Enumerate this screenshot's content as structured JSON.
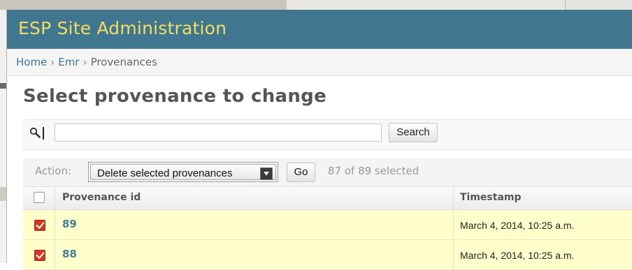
{
  "header": {
    "title": "ESP Site Administration"
  },
  "breadcrumbs": {
    "items": [
      "Home",
      "Emr",
      "Provenances"
    ],
    "separator": "›"
  },
  "page_title": "Select provenance to change",
  "search": {
    "value": "",
    "placeholder": "",
    "button_label": "Search",
    "icon": "magnifier-icon"
  },
  "actions": {
    "label": "Action:",
    "selected_option": "Delete selected provenances",
    "go_label": "Go",
    "selected_count_text": "87 of 89 selected"
  },
  "table": {
    "columns": [
      "Provenance id",
      "Timestamp"
    ],
    "rows": [
      {
        "id": "89",
        "timestamp": "March 4, 2014, 10:25 a.m.",
        "checked": true
      },
      {
        "id": "88",
        "timestamp": "March 4, 2014, 10:25 a.m.",
        "checked": true
      }
    ]
  },
  "colors": {
    "header_bg": "#417690",
    "header_text": "#f5dd5d",
    "link": "#447e9b",
    "selected_row_bg": "#ffffcc"
  }
}
